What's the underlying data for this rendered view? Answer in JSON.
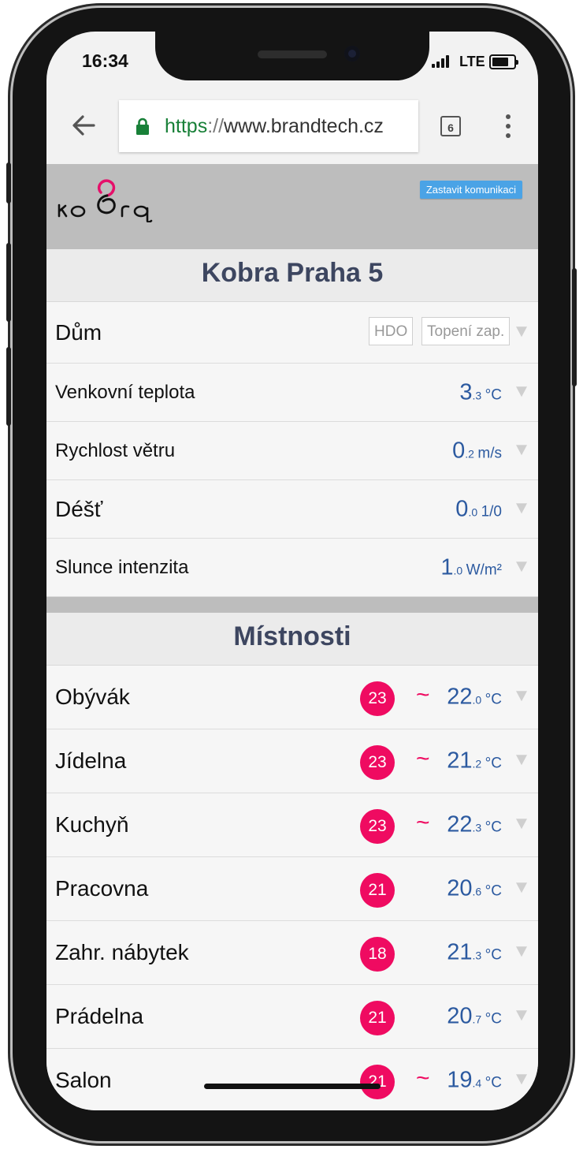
{
  "status_bar": {
    "time": "16:34",
    "network": "LTE"
  },
  "browser": {
    "url_scheme": "https",
    "url_separator": "://",
    "url_host": "www.brandtech.cz",
    "tab_count": "6"
  },
  "header": {
    "stop_button": "Zastavit komunikaci"
  },
  "sections": {
    "house_title": "Kobra Praha 5",
    "rooms_title": "Místnosti"
  },
  "house": {
    "label": "Dům",
    "tags": [
      "HDO",
      "Topení zap."
    ]
  },
  "sensors": [
    {
      "label": "Venkovní teplota",
      "int": "3",
      "dec": ".3",
      "unit": "°C"
    },
    {
      "label": "Rychlost větru",
      "int": "0",
      "dec": ".2",
      "unit": "m/s"
    },
    {
      "label": "Déšť",
      "int": "0",
      "dec": ".0",
      "unit": "1/0"
    },
    {
      "label": "Slunce intenzita",
      "int": "1",
      "dec": ".0",
      "unit": "W/m²"
    }
  ],
  "rooms": [
    {
      "label": "Obývák",
      "setpoint": "23",
      "trend": "~",
      "int": "22",
      "dec": ".0",
      "unit": "°C"
    },
    {
      "label": "Jídelna",
      "setpoint": "23",
      "trend": "~",
      "int": "21",
      "dec": ".2",
      "unit": "°C"
    },
    {
      "label": "Kuchyň",
      "setpoint": "23",
      "trend": "~",
      "int": "22",
      "dec": ".3",
      "unit": "°C"
    },
    {
      "label": "Pracovna",
      "setpoint": "21",
      "trend": "",
      "int": "20",
      "dec": ".6",
      "unit": "°C"
    },
    {
      "label": "Zahr. nábytek",
      "setpoint": "18",
      "trend": "",
      "int": "21",
      "dec": ".3",
      "unit": "°C"
    },
    {
      "label": "Prádelna",
      "setpoint": "21",
      "trend": "",
      "int": "20",
      "dec": ".7",
      "unit": "°C"
    },
    {
      "label": "Salon",
      "setpoint": "21",
      "trend": "~",
      "int": "19",
      "dec": ".4",
      "unit": "°C"
    }
  ],
  "colors": {
    "accent": "#ef0b61",
    "value": "#2c5aa0",
    "button": "#4aa3e6"
  }
}
